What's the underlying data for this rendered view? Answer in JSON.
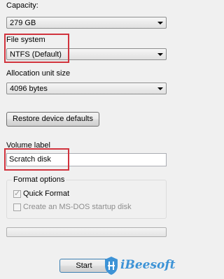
{
  "capacity": {
    "label": "Capacity:",
    "value": "279 GB"
  },
  "file_system": {
    "label": "File system",
    "value": "NTFS (Default)"
  },
  "allocation": {
    "label": "Allocation unit size",
    "value": "4096 bytes"
  },
  "restore_button": {
    "label": "Restore device defaults"
  },
  "volume": {
    "label": "Volume label",
    "value": "Scratch disk"
  },
  "format_options": {
    "title": "Format options",
    "quick_format": {
      "label": "Quick Format",
      "checked": true
    },
    "msdos_disk": {
      "label": "Create an MS-DOS startup disk",
      "checked": false
    }
  },
  "progress": {
    "fraction": 0
  },
  "start_button": {
    "label": "Start"
  },
  "logo": {
    "text": "iBeesoft"
  },
  "colors": {
    "highlight": "#d1333d",
    "brand": "#3d93d6"
  }
}
